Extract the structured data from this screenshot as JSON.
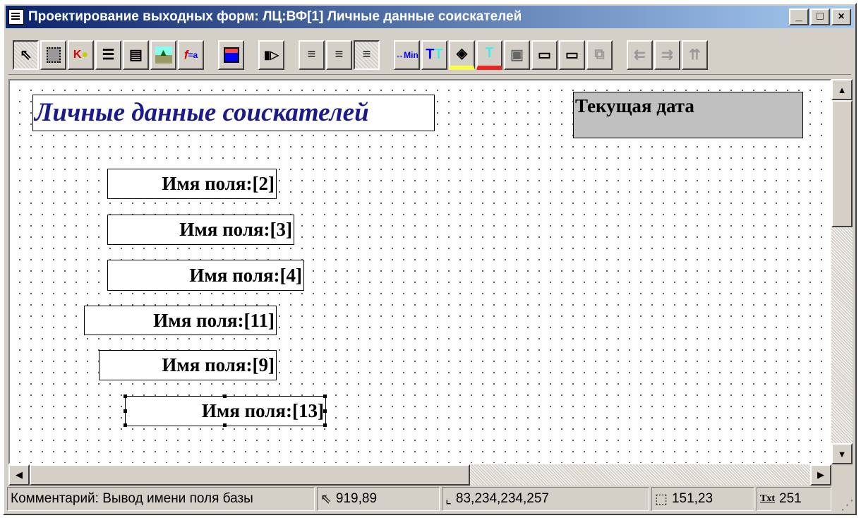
{
  "window": {
    "title": "Проектирование выходных форм: ЛЦ:ВФ[1] Личные данные соискателей",
    "minimize": "_",
    "maximize": "□",
    "close": "×"
  },
  "toolbar": {
    "buttons": [
      "pointer-icon",
      "frame-icon",
      "key-icon",
      "tree-icon",
      "tree-frame-icon",
      "picture-icon",
      "formula-icon",
      "save-icon",
      "run-icon",
      "align-left-icon",
      "align-center-icon",
      "align-right-icon",
      "min-size-icon",
      "font-size-icon",
      "fill-color-icon",
      "text-color-icon",
      "border-icon",
      "bottom-border-icon",
      "top-border-icon",
      "group-icon",
      "align-right-edge-icon",
      "align-left-edge-icon",
      "align-top-edge-icon"
    ]
  },
  "form": {
    "title": "Личные данные соискателей",
    "date_label": "Текущая дата",
    "fields": [
      "Имя поля:[2]",
      "Имя поля:[3]",
      "Имя поля:[4]",
      "Имя поля:[11]",
      "Имя поля:[9]",
      "Имя поля:[13]"
    ]
  },
  "status": {
    "comment": "Комментарий: Вывод имени поля базы",
    "cursor": "919,89",
    "rect": "83,234,234,257",
    "size": "151,23",
    "text_count": "251",
    "text_icon_label": "Txt"
  }
}
